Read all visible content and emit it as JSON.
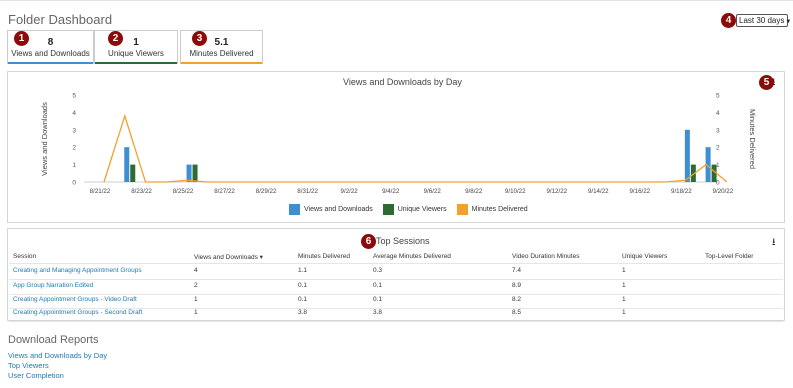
{
  "header": {
    "title": "Folder Dashboard",
    "range_select": {
      "value": "Last 30 days"
    }
  },
  "badges": [
    "1",
    "2",
    "3",
    "4",
    "5",
    "6"
  ],
  "kpis": [
    {
      "value": "8",
      "label": "Views and Downloads",
      "color": "#3d8fd1"
    },
    {
      "value": "1",
      "label": "Unique Viewers",
      "color": "#2d6b32"
    },
    {
      "value": "5.1",
      "label": "Minutes Delivered",
      "color": "#f0a22e"
    }
  ],
  "chart_data": {
    "type": "bar",
    "title": "Views and Downloads by Day",
    "ylabel": "Views and Downloads",
    "ylabel_right": "Minutes Delivered",
    "ylim": [
      0,
      5
    ],
    "y_ticks": [
      "5",
      "4",
      "3",
      "2",
      "1",
      "0"
    ],
    "x_tick_labels": [
      "8/21/22",
      "8/23/22",
      "8/25/22",
      "8/27/22",
      "8/29/22",
      "8/31/22",
      "9/2/22",
      "9/4/22",
      "9/6/22",
      "9/8/22",
      "9/10/22",
      "9/12/22",
      "9/14/22",
      "9/16/22",
      "9/18/22",
      "9/20/22"
    ],
    "x": [
      "8/21/22",
      "8/22/22",
      "8/23/22",
      "8/24/22",
      "8/25/22",
      "8/26/22",
      "8/27/22",
      "8/28/22",
      "8/29/22",
      "8/30/22",
      "8/31/22",
      "9/1/22",
      "9/2/22",
      "9/3/22",
      "9/4/22",
      "9/5/22",
      "9/6/22",
      "9/7/22",
      "9/8/22",
      "9/9/22",
      "9/10/22",
      "9/11/22",
      "9/12/22",
      "9/13/22",
      "9/14/22",
      "9/15/22",
      "9/16/22",
      "9/17/22",
      "9/18/22",
      "9/19/22",
      "9/20/22"
    ],
    "series": [
      {
        "name": "Views and Downloads",
        "kind": "bar",
        "color": "#3d8fd1",
        "values": [
          0,
          2,
          0,
          0,
          1,
          0,
          0,
          0,
          0,
          0,
          0,
          0,
          0,
          0,
          0,
          0,
          0,
          0,
          0,
          0,
          0,
          0,
          0,
          0,
          0,
          0,
          0,
          0,
          3,
          2,
          0
        ]
      },
      {
        "name": "Unique Viewers",
        "kind": "bar",
        "color": "#2d6b32",
        "values": [
          0,
          1,
          0,
          0,
          1,
          0,
          0,
          0,
          0,
          0,
          0,
          0,
          0,
          0,
          0,
          0,
          0,
          0,
          0,
          0,
          0,
          0,
          0,
          0,
          0,
          0,
          0,
          0,
          1,
          1,
          0
        ]
      },
      {
        "name": "Minutes Delivered",
        "kind": "line",
        "color": "#f0a22e",
        "values": [
          0,
          3.8,
          0,
          0,
          0.1,
          0,
          0,
          0,
          0,
          0,
          0,
          0,
          0,
          0,
          0,
          0,
          0,
          0,
          0,
          0,
          0,
          0,
          0,
          0,
          0,
          0,
          0,
          0,
          0.1,
          1,
          0
        ]
      }
    ],
    "legend": "bottom"
  },
  "top_sessions": {
    "title": "Top Sessions",
    "columns": [
      "Session",
      "Views and Downloads",
      "Minutes Delivered",
      "Average Minutes Delivered",
      "Video Duration Minutes",
      "Unique Viewers",
      "Top-Level Folder"
    ],
    "sort_indicator": "▾",
    "rows": [
      [
        "Creating and Managing Appointment Groups",
        "4",
        "1.1",
        "0.3",
        "7.4",
        "1",
        ""
      ],
      [
        "App Group Narration Edited",
        "2",
        "0.1",
        "0.1",
        "8.9",
        "1",
        ""
      ],
      [
        "Creating Appointment Groups - Video Draft",
        "1",
        "0.1",
        "0.1",
        "8.2",
        "1",
        ""
      ],
      [
        "Creating Appointment Groups - Second Draft",
        "1",
        "3.8",
        "3.8",
        "8.5",
        "1",
        ""
      ]
    ]
  },
  "download_reports": {
    "title": "Download Reports",
    "links": [
      "Views and Downloads by Day",
      "Top Viewers",
      "User Completion"
    ]
  },
  "icons": {
    "download": "download-icon",
    "dropdown": "chevron-down-icon",
    "sort": "sort-desc-icon"
  }
}
